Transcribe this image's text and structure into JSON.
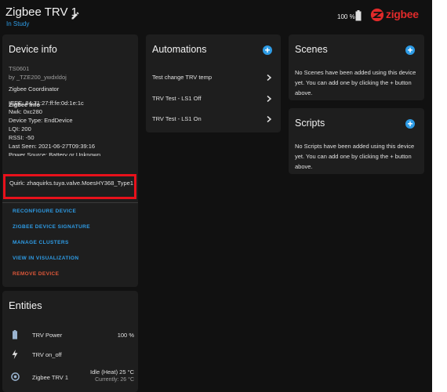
{
  "header": {
    "title": "Zigbee TRV 1",
    "subtitle": "In Study",
    "battery_text": "100 %",
    "brand": "zigbee"
  },
  "device_info": {
    "title": "Device info",
    "model": "TS0601",
    "manufacturer": "by _TZE200_ywdxldoj",
    "via": "Zigbee Coordinator",
    "zigbee_info_heading": "Zigbee info",
    "lines": [
      "IEEE: 84:71:27:ff:fe:0d:1e:1c",
      "Nwk: 0xc280",
      "Device Type: EndDevice",
      "LQI: 200",
      "RSSI: -50",
      "Last Seen: 2021-06-27T09:39:16",
      "Power Source: Battery or Unknown"
    ],
    "quirk": "Quirk: zhaquirks.tuya.valve.MoesHY368_Type1",
    "actions": {
      "reconfigure": "RECONFIGURE DEVICE",
      "signature": "ZIGBEE DEVICE SIGNATURE",
      "clusters": "MANAGE CLUSTERS",
      "visualization": "VIEW IN VISUALIZATION",
      "remove": "REMOVE DEVICE"
    }
  },
  "automations": {
    "title": "Automations",
    "items": [
      "Test change TRV temp",
      "TRV Test - LS1 Off",
      "TRV Test - LS1 On"
    ]
  },
  "scenes": {
    "title": "Scenes",
    "empty_text": "No Scenes have been added using this device yet. You can add one by clicking the + button above."
  },
  "scripts": {
    "title": "Scripts",
    "empty_text": "No Scripts have been added using this device yet. You can add one by clicking the + button above."
  },
  "entities": {
    "title": "Entities",
    "rows": [
      {
        "name": "TRV Power",
        "value": "100 %"
      },
      {
        "name": "TRV on_off",
        "value": ""
      },
      {
        "name": "Zigbee TRV 1",
        "state": "Idle (Heat) 25 °C",
        "current": "Currently: 26 °C"
      }
    ]
  },
  "colors": {
    "accent": "#2e9ce6",
    "remove": "#e0583a",
    "highlight": "#e8111b",
    "brand": "#e12a2a"
  }
}
